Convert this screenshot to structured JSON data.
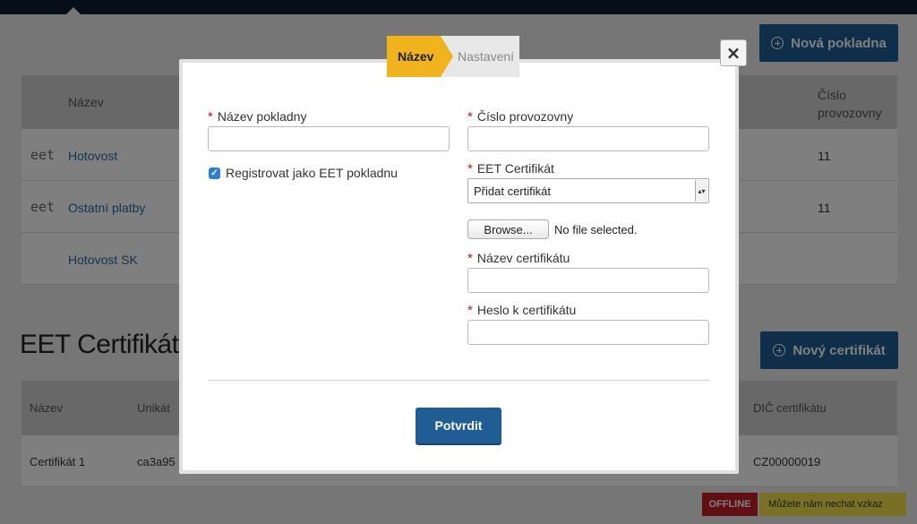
{
  "background": {
    "new_register_button": "Nová pokladna",
    "registers_table": {
      "headers": [
        "Název",
        "Číslo provozovny"
      ],
      "rows": [
        {
          "logo": "eet",
          "name": "Hotovost",
          "number": "11"
        },
        {
          "logo": "eet",
          "name": "Ostatní platby",
          "number": "11"
        },
        {
          "logo": "",
          "name": "Hotovost SK",
          "number": ""
        }
      ]
    },
    "certificates_section_title": "EET Certifikáty",
    "new_certificate_button": "Nový certifikát",
    "certificates_table": {
      "headers": [
        "Název",
        "Unikát",
        "DIČ certifikátu"
      ],
      "rows": [
        {
          "name": "Certifikát 1",
          "unique": "ca3a95",
          "dic": "CZ00000019"
        }
      ]
    },
    "chat": {
      "status": "OFFLINE",
      "message": "Můžete nám nechat vzkaz"
    }
  },
  "modal": {
    "close_label": "×",
    "wizard": {
      "active_step": "Název",
      "next_step": "Nastavení"
    },
    "left": {
      "register_name_label": "Název pokladny",
      "register_name_value": "",
      "eet_checkbox_label": "Registrovat jako EET pokladnu",
      "eet_checkbox_checked": true
    },
    "right": {
      "establishment_label": "Číslo provozovny",
      "establishment_value": "",
      "certificate_label": "EET Certifikát",
      "certificate_selected": "Přidat certifikát",
      "browse_label": "Browse...",
      "file_status": "No file selected.",
      "certificate_name_label": "Název certifikátu",
      "certificate_name_value": "",
      "certificate_password_label": "Heslo k certifikátu",
      "certificate_password_value": ""
    },
    "confirm_label": "Potvrdit"
  },
  "colors": {
    "primary": "#1f5d94",
    "wizard_active": "#f0b21d",
    "required": "#b01e24",
    "offline": "#c0202a"
  }
}
